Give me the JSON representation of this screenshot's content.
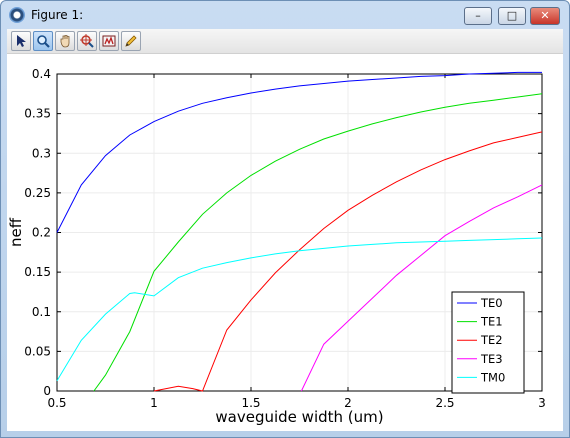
{
  "window": {
    "title": "Figure 1:"
  },
  "titlebar_buttons": {
    "minimize": "–",
    "maximize": "□",
    "close": "✕"
  },
  "toolbar": [
    {
      "name": "pointer-tool-button",
      "icon": "arrow-pointer-icon",
      "active": false
    },
    {
      "name": "zoom-tool-button",
      "icon": "magnifier-icon",
      "active": true
    },
    {
      "name": "pan-tool-button",
      "icon": "hand-icon",
      "active": false
    },
    {
      "name": "datatip-tool-button",
      "icon": "crosshair-icon",
      "active": false
    },
    {
      "name": "brush-tool-button",
      "icon": "brush-icon",
      "active": false
    },
    {
      "name": "edit-tool-button",
      "icon": "pencil-icon",
      "active": false
    }
  ],
  "chart_data": {
    "type": "line",
    "xlabel": "waveguide width (um)",
    "ylabel": "neff",
    "xlim": [
      0.5,
      3
    ],
    "ylim": [
      0,
      0.4
    ],
    "xticks": [
      "0.5",
      "1",
      "1.5",
      "2",
      "2.5",
      "3"
    ],
    "yticks": [
      "0",
      "0.05",
      "0.1",
      "0.15",
      "0.2",
      "0.25",
      "0.3",
      "0.35",
      "0.4"
    ],
    "grid": true,
    "legend_position": "bottom-right",
    "series": [
      {
        "name": "TE0",
        "color": "#0000ff",
        "x": [
          0.5,
          0.625,
          0.75,
          0.875,
          1.0,
          1.125,
          1.25,
          1.375,
          1.5,
          1.625,
          1.75,
          1.875,
          2.0,
          2.125,
          2.25,
          2.375,
          2.5,
          2.625,
          2.75,
          2.875,
          3.0
        ],
        "y": [
          0.2,
          0.26,
          0.297,
          0.323,
          0.34,
          0.353,
          0.363,
          0.37,
          0.376,
          0.381,
          0.385,
          0.388,
          0.391,
          0.393,
          0.395,
          0.397,
          0.398,
          0.4,
          0.401,
          0.402,
          0.402
        ]
      },
      {
        "name": "TE1",
        "color": "#00e000",
        "x": [
          0.69,
          0.75,
          0.875,
          1.0,
          1.125,
          1.25,
          1.375,
          1.5,
          1.625,
          1.75,
          1.875,
          2.0,
          2.125,
          2.25,
          2.375,
          2.5,
          2.625,
          2.75,
          2.875,
          3.0
        ],
        "y": [
          0.0,
          0.02,
          0.075,
          0.151,
          0.188,
          0.223,
          0.25,
          0.272,
          0.29,
          0.305,
          0.318,
          0.328,
          0.337,
          0.345,
          0.352,
          0.358,
          0.363,
          0.367,
          0.371,
          0.375
        ]
      },
      {
        "name": "TE2",
        "color": "#ff0000",
        "x": [
          1.0,
          1.125,
          1.2,
          1.25,
          1.375,
          1.5,
          1.625,
          1.75,
          1.875,
          2.0,
          2.125,
          2.25,
          2.375,
          2.5,
          2.625,
          2.75,
          2.875,
          3.0
        ],
        "y": [
          0.0,
          0.006,
          0.003,
          0.0,
          0.077,
          0.115,
          0.149,
          0.178,
          0.205,
          0.228,
          0.247,
          0.264,
          0.279,
          0.292,
          0.303,
          0.313,
          0.32,
          0.327
        ]
      },
      {
        "name": "TE3",
        "color": "#ff00ff",
        "x": [
          1.76,
          1.875,
          2.0,
          2.125,
          2.25,
          2.375,
          2.5,
          2.625,
          2.75,
          2.875,
          3.0
        ],
        "y": [
          0.0,
          0.059,
          0.088,
          0.117,
          0.146,
          0.171,
          0.196,
          0.214,
          0.231,
          0.245,
          0.26
        ]
      },
      {
        "name": "TM0",
        "color": "#00ffff",
        "x": [
          0.5,
          0.625,
          0.75,
          0.875,
          0.9,
          1.0,
          1.125,
          1.25,
          1.375,
          1.5,
          1.625,
          1.75,
          1.875,
          2.0,
          2.125,
          2.25,
          2.375,
          2.5,
          2.625,
          2.75,
          2.875,
          3.0
        ],
        "y": [
          0.013,
          0.064,
          0.097,
          0.123,
          0.124,
          0.12,
          0.143,
          0.155,
          0.162,
          0.168,
          0.173,
          0.177,
          0.18,
          0.183,
          0.185,
          0.187,
          0.188,
          0.189,
          0.19,
          0.191,
          0.192,
          0.193
        ]
      }
    ]
  }
}
